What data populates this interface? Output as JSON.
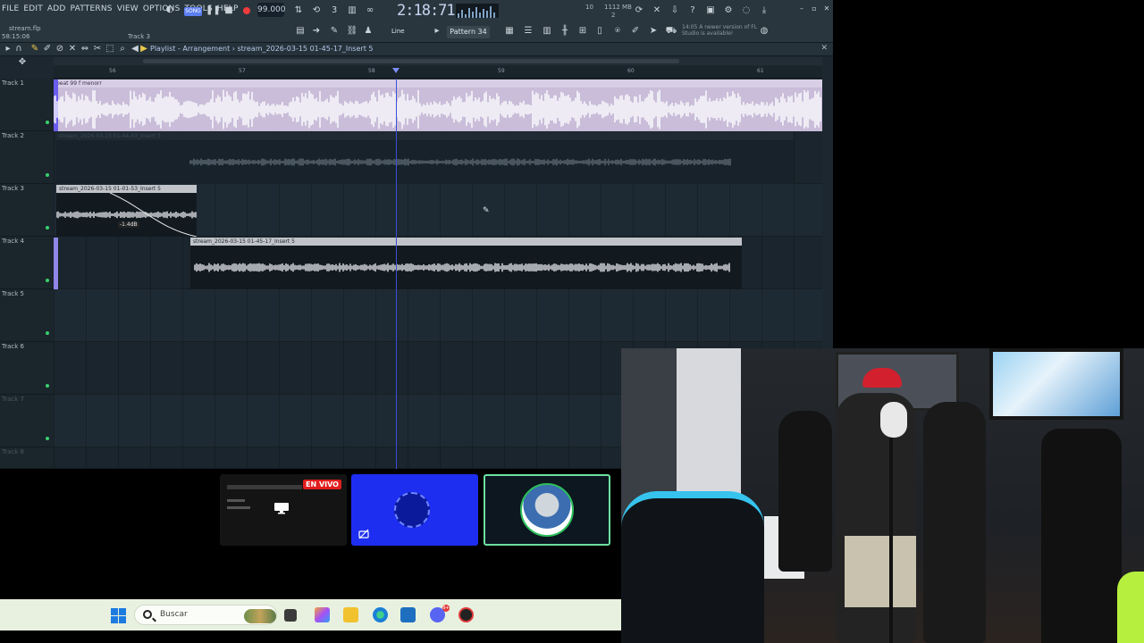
{
  "fl_studio": {
    "menu": [
      "FILE",
      "EDIT",
      "ADD",
      "PATTERNS",
      "VIEW",
      "OPTIONS",
      "TOOLS",
      "HELP"
    ],
    "project_file": "stream.flp",
    "elapsed": "58:15:06",
    "hint_track": "Track 3",
    "song_button": "SONG",
    "tempo": "99.000",
    "time": "2:18:71",
    "cpu": "10",
    "memory": "1112 MB",
    "polyphony": "2",
    "snap": "Line",
    "pattern": "Pattern 34",
    "update_note_time": "14:05",
    "update_note": "A newer version of FL Studio is available!"
  },
  "playlist": {
    "breadcrumb": "Playlist - Arrangement › stream_2026-03-15 01-45-17_Insert 5",
    "ruler_numbers": [
      "56",
      "57",
      "58",
      "59",
      "60",
      "61"
    ],
    "tracks": [
      {
        "label": "Track 1",
        "dim": false
      },
      {
        "label": "Track 2",
        "dim": false
      },
      {
        "label": "Track 3",
        "dim": false
      },
      {
        "label": "Track 4",
        "dim": false
      },
      {
        "label": "Track 5",
        "dim": false
      },
      {
        "label": "Track 6",
        "dim": false
      },
      {
        "label": "Track 7",
        "dim": true
      },
      {
        "label": "Track 8",
        "dim": true
      }
    ],
    "clips": {
      "beat": "beat 99 f menorr",
      "track2": "stream_2026-03-15 01-44-43_Insert 5",
      "track3": "stream_2026-03-15 01-01-53_Insert 5",
      "track4": "stream_2026-03-15 01-45-17_Insert 5"
    },
    "fade_level": "-1.4dB"
  },
  "thumbnails": {
    "live_badge": "EN VIVO"
  },
  "taskbar": {
    "search_placeholder": "Buscar",
    "discord_badge": "9+"
  },
  "colors": {
    "playhead": "#3c4fd8",
    "beat_clip": "#c9bdd9",
    "live_badge": "#e11d1d",
    "start_icon": "#1d7be0"
  }
}
